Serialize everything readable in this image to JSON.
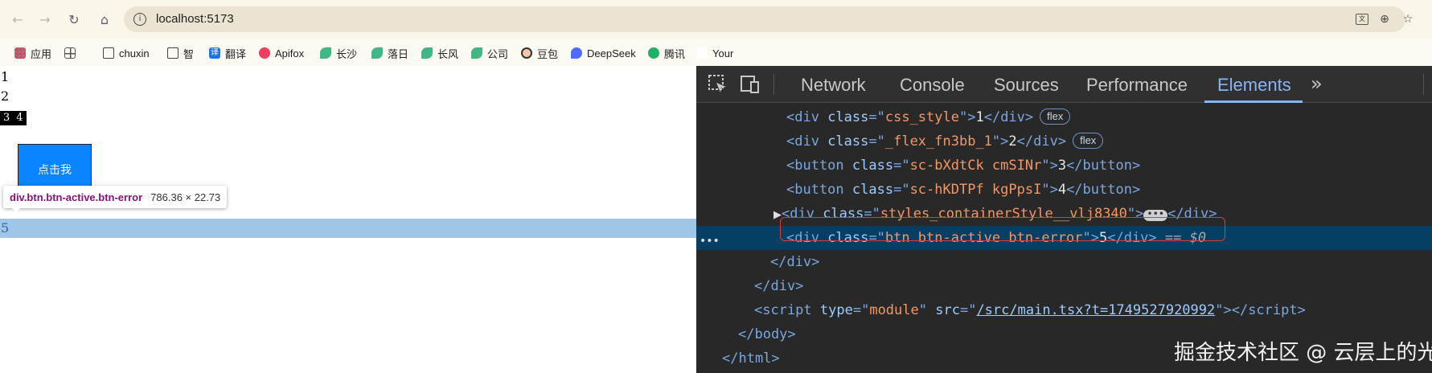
{
  "browser": {
    "url": "localhost:5173",
    "nav_icons": [
      "back-icon",
      "forward-icon",
      "reload-icon",
      "home-icon"
    ],
    "omnibox_icons": [
      "translate-icon",
      "zoom-icon",
      "bookmark-star-icon"
    ],
    "bookmarks": [
      {
        "label": "应用",
        "icon": "apps-grid-icon"
      },
      {
        "label": "",
        "icon": "tab-groups-icon"
      },
      {
        "label": "chuxin",
        "icon": "folder-icon"
      },
      {
        "label": "智",
        "icon": "folder-icon"
      },
      {
        "label": "翻译",
        "icon": "translate-icon",
        "icon_text": "译"
      },
      {
        "label": "Apifox",
        "icon": "apifox-icon"
      },
      {
        "label": "长沙",
        "icon": "leaf-icon"
      },
      {
        "label": "落日",
        "icon": "leaf-icon"
      },
      {
        "label": "长风",
        "icon": "leaf-icon"
      },
      {
        "label": "公司",
        "icon": "leaf-icon"
      },
      {
        "label": "豆包",
        "icon": "doubao-icon"
      },
      {
        "label": "DeepSeek",
        "icon": "deepseek-icon"
      },
      {
        "label": "腾讯",
        "icon": "tencent-icon"
      },
      {
        "label": "Your",
        "icon": "blank-page-icon"
      }
    ]
  },
  "page": {
    "line1": "1",
    "line2": "2",
    "button3": "3",
    "button4": "4",
    "click_button": "点击我",
    "tooltip_selector": "div.btn.btn-active.btn-error",
    "tooltip_size": "786.36 × 22.73",
    "highlighted_text": "5"
  },
  "devtools": {
    "tabs": [
      "Network",
      "Console",
      "Sources",
      "Performance",
      "Elements"
    ],
    "active_tab": "Elements",
    "more_tabs": "»",
    "badge_flex": "flex",
    "selected_marker": "== $0",
    "dom": {
      "l1": {
        "cls": "css_style",
        "text": "1"
      },
      "l2": {
        "cls": "_flex_fn3bb_1",
        "text": "2"
      },
      "l3": {
        "cls": "sc-bXdtCk cmSINr",
        "text": "3"
      },
      "l4": {
        "cls": "sc-hKDTPf kgPpsI",
        "text": "4"
      },
      "l5": {
        "cls": "styles_containerStyle__vlj8340"
      },
      "l6": {
        "cls": "btn btn-active btn-error",
        "text": "5"
      },
      "script": {
        "type": "module",
        "src": "/src/main.tsx?t=1749527920992"
      }
    },
    "accent_color": "#8ab4f8",
    "highlight_box_color": "#e03a3a"
  },
  "watermark": "掘金技术社区 @ 云层上的光"
}
